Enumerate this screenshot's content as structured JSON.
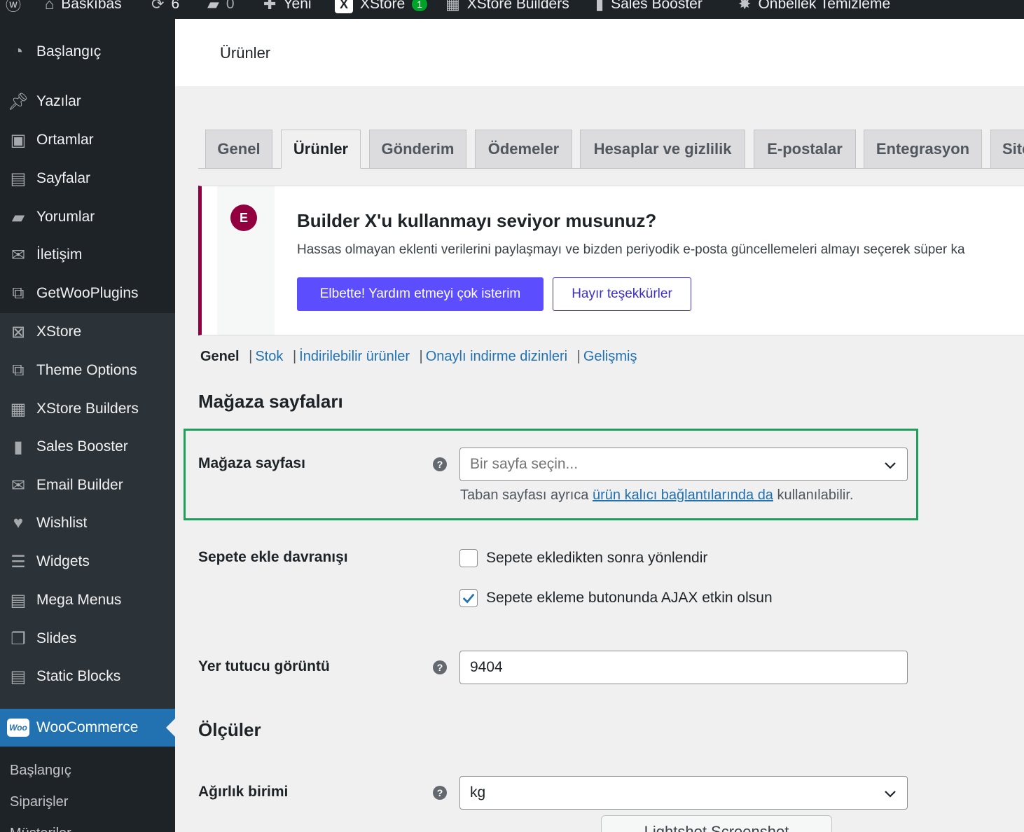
{
  "admin_bar": {
    "site_name": "Baskıbas",
    "updates_count": "6",
    "comments_count": "0",
    "new_label": "Yeni",
    "xstore_label": "XStore",
    "xstore_badge": "1",
    "xstore_builders_label": "XStore Builders",
    "sales_booster_label": "Sales Booster",
    "cache_label": "Önbellek Temizleme"
  },
  "sidebar": {
    "items": [
      {
        "label": "Başlangıç",
        "icon": "dashboard-icon"
      },
      {
        "label": "Yazılar",
        "icon": "pin-icon"
      },
      {
        "label": "Ortamlar",
        "icon": "media-icon"
      },
      {
        "label": "Sayfalar",
        "icon": "pages-icon"
      },
      {
        "label": "Yorumlar",
        "icon": "comments-icon"
      },
      {
        "label": "İletişim",
        "icon": "mail-icon"
      },
      {
        "label": "GetWooPlugins",
        "icon": "plugin-icon"
      },
      {
        "label": "XStore",
        "icon": "xstore-icon"
      },
      {
        "label": "Theme Options",
        "icon": "options-icon"
      },
      {
        "label": "XStore Builders",
        "icon": "builders-icon"
      },
      {
        "label": "Sales Booster",
        "icon": "chart-icon"
      },
      {
        "label": "Email Builder",
        "icon": "email-icon"
      },
      {
        "label": "Wishlist",
        "icon": "heart-icon"
      },
      {
        "label": "Widgets",
        "icon": "widgets-icon"
      },
      {
        "label": "Mega Menus",
        "icon": "menus-icon"
      },
      {
        "label": "Slides",
        "icon": "slides-icon"
      },
      {
        "label": "Static Blocks",
        "icon": "blocks-icon"
      }
    ],
    "woocommerce": {
      "label": "WooCommerce",
      "badge": "Woo"
    },
    "submenu": [
      "Başlangıç",
      "Siparişler",
      "Müşteriler"
    ]
  },
  "page": {
    "title": "Ürünler"
  },
  "tabs": [
    "Genel",
    "Ürünler",
    "Gönderim",
    "Ödemeler",
    "Hesaplar ve gizlilik",
    "E-postalar",
    "Entegrasyon",
    "Site"
  ],
  "notice": {
    "logo_letter": "E",
    "heading": "Builder X'u kullanmayı seviyor musunuz?",
    "text": "Hassas olmayan eklenti verilerini paylaşmayı ve bizden periyodik e-posta güncellemeleri almayı seçerek süper ka",
    "accept_label": "Elbette! Yardım etmeyi çok isterim",
    "decline_label": "Hayır teşekkürler"
  },
  "subnav": {
    "current": "Genel",
    "links": [
      "Stok",
      "İndirilebilir ürünler",
      "Onaylı indirme dizinleri",
      "Gelişmiş"
    ],
    "separator": "|"
  },
  "sections": {
    "shop_pages": "Mağaza sayfaları",
    "dimensions": "Ölçüler"
  },
  "fields": {
    "shop_page": {
      "label": "Mağaza sayfası",
      "placeholder": "Bir sayfa seçin...",
      "desc_before": "Taban sayfası ayrıca ",
      "desc_link": "ürün kalıcı bağlantılarında da",
      "desc_after": " kullanılabilir."
    },
    "add_to_cart": {
      "label": "Sepete ekle davranışı",
      "option1": "Sepete ekledikten sonra yönlendir",
      "option1_checked": false,
      "option2": "Sepete ekleme butonunda AJAX etkin olsun",
      "option2_checked": true
    },
    "placeholder_image": {
      "label": "Yer tutucu görüntü",
      "value": "9404"
    },
    "weight_unit": {
      "label": "Ağırlık birimi",
      "value": "kg"
    }
  },
  "help_symbol": "?",
  "lightshot_label": "Lightshot Screenshot",
  "colors": {
    "admin_dark": "#1d2327",
    "submenu_dark": "#2c3338",
    "active_blue": "#2271b1",
    "notice_accent": "#93003f",
    "primary_button": "#5c4dff",
    "highlight_green": "#1ea05a"
  }
}
